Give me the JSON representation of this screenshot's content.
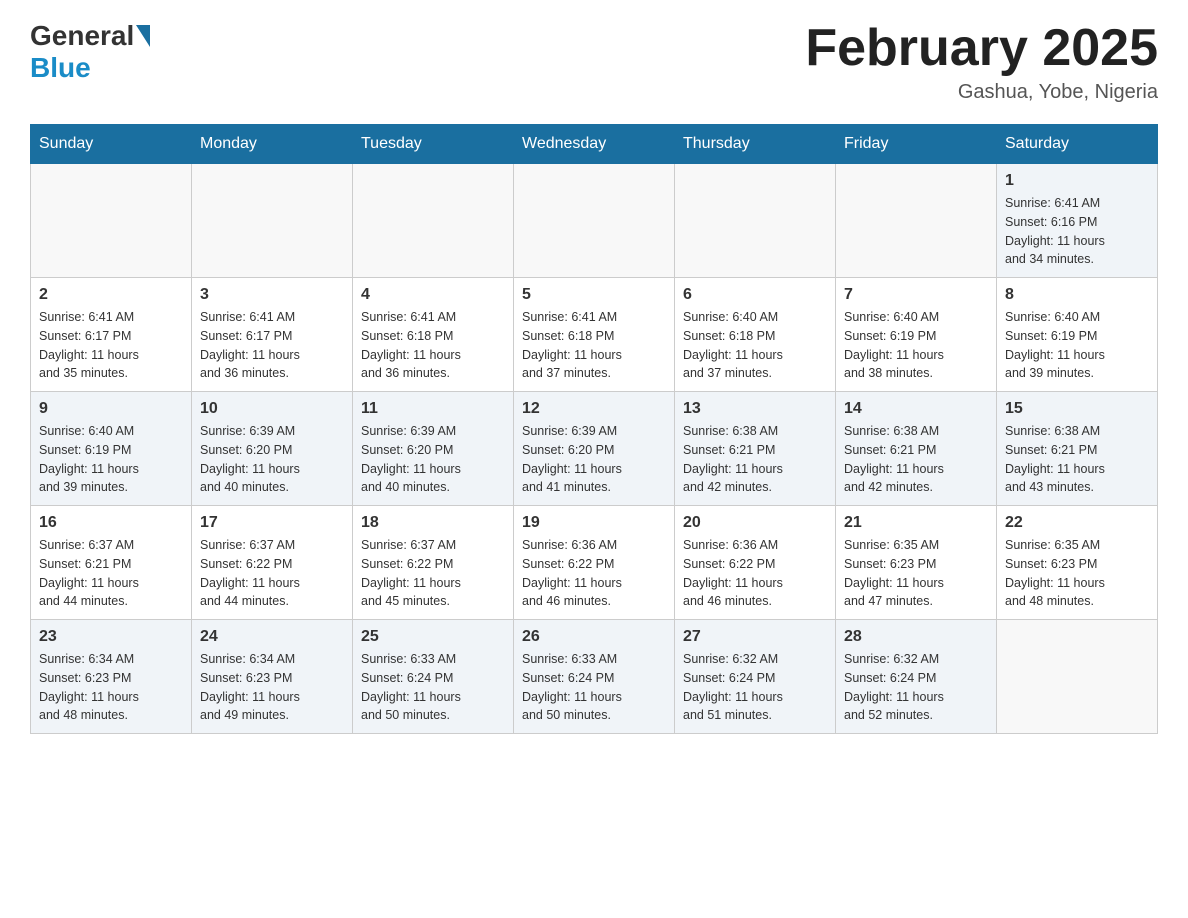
{
  "header": {
    "logo": {
      "general": "General",
      "blue": "Blue"
    },
    "title": "February 2025",
    "location": "Gashua, Yobe, Nigeria"
  },
  "days_of_week": [
    "Sunday",
    "Monday",
    "Tuesday",
    "Wednesday",
    "Thursday",
    "Friday",
    "Saturday"
  ],
  "weeks": [
    {
      "days": [
        {
          "num": "",
          "info": ""
        },
        {
          "num": "",
          "info": ""
        },
        {
          "num": "",
          "info": ""
        },
        {
          "num": "",
          "info": ""
        },
        {
          "num": "",
          "info": ""
        },
        {
          "num": "",
          "info": ""
        },
        {
          "num": "1",
          "info": "Sunrise: 6:41 AM\nSunset: 6:16 PM\nDaylight: 11 hours\nand 34 minutes."
        }
      ]
    },
    {
      "days": [
        {
          "num": "2",
          "info": "Sunrise: 6:41 AM\nSunset: 6:17 PM\nDaylight: 11 hours\nand 35 minutes."
        },
        {
          "num": "3",
          "info": "Sunrise: 6:41 AM\nSunset: 6:17 PM\nDaylight: 11 hours\nand 36 minutes."
        },
        {
          "num": "4",
          "info": "Sunrise: 6:41 AM\nSunset: 6:18 PM\nDaylight: 11 hours\nand 36 minutes."
        },
        {
          "num": "5",
          "info": "Sunrise: 6:41 AM\nSunset: 6:18 PM\nDaylight: 11 hours\nand 37 minutes."
        },
        {
          "num": "6",
          "info": "Sunrise: 6:40 AM\nSunset: 6:18 PM\nDaylight: 11 hours\nand 37 minutes."
        },
        {
          "num": "7",
          "info": "Sunrise: 6:40 AM\nSunset: 6:19 PM\nDaylight: 11 hours\nand 38 minutes."
        },
        {
          "num": "8",
          "info": "Sunrise: 6:40 AM\nSunset: 6:19 PM\nDaylight: 11 hours\nand 39 minutes."
        }
      ]
    },
    {
      "days": [
        {
          "num": "9",
          "info": "Sunrise: 6:40 AM\nSunset: 6:19 PM\nDaylight: 11 hours\nand 39 minutes."
        },
        {
          "num": "10",
          "info": "Sunrise: 6:39 AM\nSunset: 6:20 PM\nDaylight: 11 hours\nand 40 minutes."
        },
        {
          "num": "11",
          "info": "Sunrise: 6:39 AM\nSunset: 6:20 PM\nDaylight: 11 hours\nand 40 minutes."
        },
        {
          "num": "12",
          "info": "Sunrise: 6:39 AM\nSunset: 6:20 PM\nDaylight: 11 hours\nand 41 minutes."
        },
        {
          "num": "13",
          "info": "Sunrise: 6:38 AM\nSunset: 6:21 PM\nDaylight: 11 hours\nand 42 minutes."
        },
        {
          "num": "14",
          "info": "Sunrise: 6:38 AM\nSunset: 6:21 PM\nDaylight: 11 hours\nand 42 minutes."
        },
        {
          "num": "15",
          "info": "Sunrise: 6:38 AM\nSunset: 6:21 PM\nDaylight: 11 hours\nand 43 minutes."
        }
      ]
    },
    {
      "days": [
        {
          "num": "16",
          "info": "Sunrise: 6:37 AM\nSunset: 6:21 PM\nDaylight: 11 hours\nand 44 minutes."
        },
        {
          "num": "17",
          "info": "Sunrise: 6:37 AM\nSunset: 6:22 PM\nDaylight: 11 hours\nand 44 minutes."
        },
        {
          "num": "18",
          "info": "Sunrise: 6:37 AM\nSunset: 6:22 PM\nDaylight: 11 hours\nand 45 minutes."
        },
        {
          "num": "19",
          "info": "Sunrise: 6:36 AM\nSunset: 6:22 PM\nDaylight: 11 hours\nand 46 minutes."
        },
        {
          "num": "20",
          "info": "Sunrise: 6:36 AM\nSunset: 6:22 PM\nDaylight: 11 hours\nand 46 minutes."
        },
        {
          "num": "21",
          "info": "Sunrise: 6:35 AM\nSunset: 6:23 PM\nDaylight: 11 hours\nand 47 minutes."
        },
        {
          "num": "22",
          "info": "Sunrise: 6:35 AM\nSunset: 6:23 PM\nDaylight: 11 hours\nand 48 minutes."
        }
      ]
    },
    {
      "days": [
        {
          "num": "23",
          "info": "Sunrise: 6:34 AM\nSunset: 6:23 PM\nDaylight: 11 hours\nand 48 minutes."
        },
        {
          "num": "24",
          "info": "Sunrise: 6:34 AM\nSunset: 6:23 PM\nDaylight: 11 hours\nand 49 minutes."
        },
        {
          "num": "25",
          "info": "Sunrise: 6:33 AM\nSunset: 6:24 PM\nDaylight: 11 hours\nand 50 minutes."
        },
        {
          "num": "26",
          "info": "Sunrise: 6:33 AM\nSunset: 6:24 PM\nDaylight: 11 hours\nand 50 minutes."
        },
        {
          "num": "27",
          "info": "Sunrise: 6:32 AM\nSunset: 6:24 PM\nDaylight: 11 hours\nand 51 minutes."
        },
        {
          "num": "28",
          "info": "Sunrise: 6:32 AM\nSunset: 6:24 PM\nDaylight: 11 hours\nand 52 minutes."
        },
        {
          "num": "",
          "info": ""
        }
      ]
    }
  ]
}
